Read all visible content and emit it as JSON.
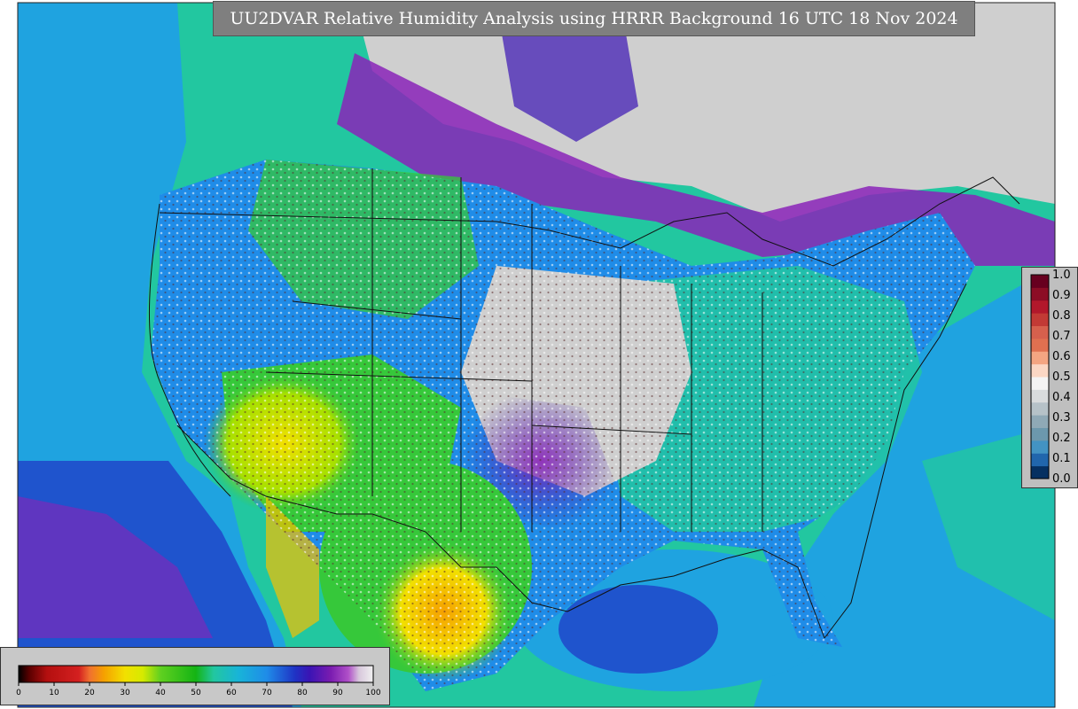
{
  "title": "UU2DVAR Relative Humidity Analysis using HRRR Background 16 UTC 18 Nov 2024",
  "colors": {
    "ocean_green": "#22c7a0",
    "ocean_blue": "#1fa3e0",
    "deep_blue": "#1f32c4",
    "purple": "#8a23b8",
    "saturated_gray": "#cfcfcf",
    "dry_yellow": "#f2e000",
    "dry_orange": "#f5a000",
    "dry_red": "#c81a1a",
    "land_green": "#36c83a"
  },
  "rh_colorbar": {
    "ticks": [
      "0",
      "10",
      "20",
      "30",
      "40",
      "50",
      "60",
      "70",
      "80",
      "90",
      "100"
    ],
    "stops": [
      {
        "v": 0,
        "c": "#000000"
      },
      {
        "v": 3,
        "c": "#5a0000"
      },
      {
        "v": 8,
        "c": "#b40f0f"
      },
      {
        "v": 17,
        "c": "#d42020"
      },
      {
        "v": 20,
        "c": "#f07030"
      },
      {
        "v": 24,
        "c": "#f5a000"
      },
      {
        "v": 30,
        "c": "#f2e000"
      },
      {
        "v": 35,
        "c": "#d6ea00"
      },
      {
        "v": 40,
        "c": "#60d020"
      },
      {
        "v": 50,
        "c": "#14b414"
      },
      {
        "v": 55,
        "c": "#22c7a0"
      },
      {
        "v": 62,
        "c": "#18b4d8"
      },
      {
        "v": 70,
        "c": "#1f8ce8"
      },
      {
        "v": 78,
        "c": "#1f32c4"
      },
      {
        "v": 82,
        "c": "#3a14b4"
      },
      {
        "v": 88,
        "c": "#7a1cb0"
      },
      {
        "v": 93,
        "c": "#b050c8"
      },
      {
        "v": 96,
        "c": "#d8c8dc"
      },
      {
        "v": 100,
        "c": "#f0f0f0"
      }
    ]
  },
  "qc_colorbar": {
    "ticks": [
      "0.0",
      "0.1",
      "0.2",
      "0.3",
      "0.4",
      "0.5",
      "0.6",
      "0.7",
      "0.8",
      "0.9",
      "1.0"
    ],
    "colors": [
      "#053061",
      "#2166ac",
      "#4393c3",
      "#6c98ad",
      "#8fa9b6",
      "#b6c2c8",
      "#d9dcdd",
      "#f4f4f4",
      "#fbd7c4",
      "#f4a582",
      "#e07050",
      "#d6604d",
      "#c23a35",
      "#b2182b",
      "#8c0d25",
      "#67001f"
    ]
  }
}
